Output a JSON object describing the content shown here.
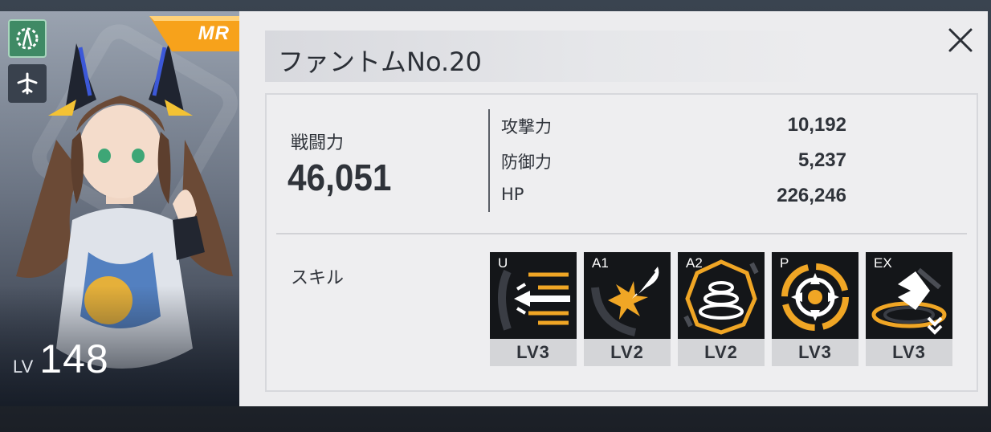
{
  "character": {
    "rarity": "MR",
    "level_prefix": "LV",
    "level": "148",
    "class_icon": "gear-sword-class-icon",
    "type_icon": "aircraft-type-icon",
    "colors": {
      "class_bg": "#3f8a65",
      "rarity_accent": "#f7a21b"
    }
  },
  "panel": {
    "name": "ファントムNo.20",
    "close_icon": "close-icon",
    "combat_power_label": "戦闘力",
    "combat_power": "46,051",
    "stats": [
      {
        "name": "攻撃力",
        "value": "10,192"
      },
      {
        "name": "防御力",
        "value": "5,237"
      },
      {
        "name": "HP",
        "value": "226,246"
      }
    ],
    "skills_label": "スキル",
    "skills": [
      {
        "tag": "U",
        "level": "LV3",
        "icon": "ultimate-arrows-icon"
      },
      {
        "tag": "A1",
        "level": "LV2",
        "icon": "burst-strike-icon"
      },
      {
        "tag": "A2",
        "level": "LV2",
        "icon": "ring-spring-icon"
      },
      {
        "tag": "P",
        "level": "LV3",
        "icon": "target-crosshair-icon"
      },
      {
        "tag": "EX",
        "level": "LV3",
        "icon": "ex-rank-up-icon"
      }
    ],
    "accent_color": "#f0a625"
  }
}
